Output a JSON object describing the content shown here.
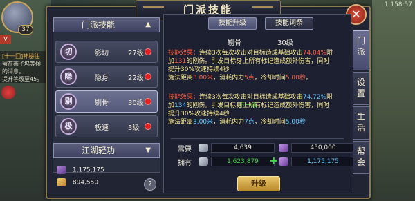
{
  "hud": {
    "player_level": "37",
    "vip": "V",
    "quest_title": "[十一回]神秘往",
    "quest_lines": [
      "留在燕子坞等候",
      "的消息。",
      "提升等级至45。"
    ],
    "coords": "1 158:57"
  },
  "window": {
    "title": "门派技能",
    "close_label": "✕"
  },
  "skill_list": {
    "section_title": "门派技能",
    "section_arrow": "▲",
    "skills": [
      {
        "icon": "切",
        "name": "影切",
        "level": "27级",
        "red_dot": true,
        "selected": false
      },
      {
        "icon": "隐",
        "name": "隐身",
        "level": "22级",
        "red_dot": true,
        "selected": false
      },
      {
        "icon": "剔",
        "name": "剔骨",
        "level": "30级",
        "red_dot": true,
        "selected": true
      },
      {
        "icon": "极",
        "name": "极速",
        "level": "3级",
        "red_dot": true,
        "selected": false
      }
    ],
    "second_section_title": "江湖轻功",
    "second_section_arrow": "▼",
    "currency_1": "1,175,175",
    "currency_2": "894,550",
    "help_label": "?"
  },
  "detail": {
    "tab_upgrade": "技能升级",
    "tab_entry": "技能词条",
    "skill_name": "剔骨",
    "skill_level": "30级",
    "current_effect": {
      "prefix": "技能效果：",
      "line1": "连续3次每次攻击对目标造成基础攻击",
      "pct": "74.04%",
      "line1b": "附",
      "line2a": "加",
      "add": "131",
      "line2b": "的刚伤。引发目标身上所有标记造成额外伤害，同时",
      "line3": "提升30%攻速持续4秒",
      "line4a": "施法距离",
      "range": "3.00米",
      "line4b": "，消耗内力",
      "cost": "5点",
      "line4c": "，冷却时间",
      "cooldown": "5.00秒",
      "line4d": "。"
    },
    "next_level_label": "下一级",
    "next_effect": {
      "prefix": "技能效果：",
      "line1": "连续3次每次攻击对目标造成基础攻击",
      "pct": "74.72%",
      "line1b": "附",
      "line2a": "加",
      "add": "134",
      "line2b": "的刚伤。引发目标身上所有标记造成额外伤害，同时",
      "line3": "提升30%攻速持续4秒",
      "line4a": "施法距离",
      "range": "3.00米",
      "line4b": "，消耗内力",
      "cost": "7点",
      "line4c": "，冷却时间",
      "cooldown": "5.00秒"
    },
    "need_label": "需要",
    "have_label": "拥有",
    "need_a": "4,639",
    "need_b": "450,000",
    "have_a": "1,623,879",
    "have_b": "1,175,175",
    "plus_label": "+",
    "upgrade_button": "升级"
  },
  "side_tabs": [
    {
      "label": "门派",
      "active": true
    },
    {
      "label": "设置",
      "active": false
    },
    {
      "label": "生活",
      "active": false
    },
    {
      "label": "帮会",
      "active": false
    }
  ],
  "colors": {
    "highlight_red": "#ff5a3c",
    "highlight_blue": "#5fc8ff",
    "desc_yellow": "#f5e48c",
    "green": "#3fd44a"
  }
}
